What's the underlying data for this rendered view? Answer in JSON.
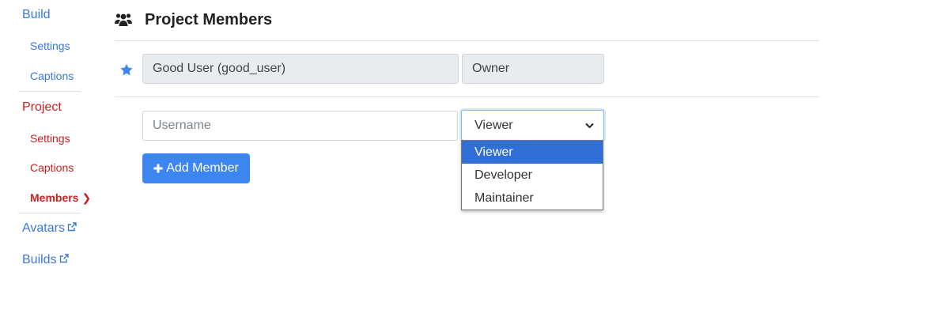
{
  "sidebar": {
    "build": {
      "label": "Build",
      "settings": "Settings",
      "captions": "Captions"
    },
    "project": {
      "label": "Project",
      "settings": "Settings",
      "captions": "Captions",
      "members": "Members"
    },
    "avatars": "Avatars",
    "builds": "Builds"
  },
  "page": {
    "title": "Project Members",
    "icon": "users-icon"
  },
  "owner_row": {
    "member": "Good User (good_user)",
    "role": "Owner",
    "icon": "star-icon"
  },
  "add_form": {
    "username_placeholder": "Username",
    "role_selected": "Viewer",
    "role_options": [
      "Viewer",
      "Developer",
      "Maintainer"
    ],
    "add_button_label": "Add Member"
  },
  "colors": {
    "link_blue": "#3a78d8",
    "active_red": "#cc1f1f",
    "button_blue": "#3d86f1",
    "option_highlight": "#2f6fd6"
  }
}
